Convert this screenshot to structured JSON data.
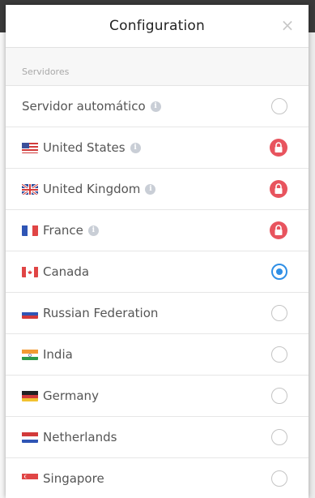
{
  "dialog": {
    "title": "Configuration",
    "close_glyph": "×"
  },
  "section": {
    "label": "Servidores"
  },
  "servers": [
    {
      "label": "Servidor automático",
      "flag": "",
      "info": true,
      "state": "unselected"
    },
    {
      "label": "United States",
      "flag": "us",
      "info": true,
      "state": "locked"
    },
    {
      "label": "United Kingdom",
      "flag": "gb",
      "info": true,
      "state": "locked"
    },
    {
      "label": "France",
      "flag": "fr",
      "info": true,
      "state": "locked"
    },
    {
      "label": "Canada",
      "flag": "ca",
      "info": false,
      "state": "selected"
    },
    {
      "label": "Russian Federation",
      "flag": "ru",
      "info": false,
      "state": "unselected"
    },
    {
      "label": "India",
      "flag": "in",
      "info": false,
      "state": "unselected"
    },
    {
      "label": "Germany",
      "flag": "de",
      "info": false,
      "state": "unselected"
    },
    {
      "label": "Netherlands",
      "flag": "nl",
      "info": false,
      "state": "unselected"
    },
    {
      "label": "Singapore",
      "flag": "sg",
      "info": false,
      "state": "unselected"
    }
  ],
  "colors": {
    "accent": "#2f8fe6",
    "lock": "#e8545e"
  },
  "icons": {
    "info": "info-icon",
    "lock": "lock-icon",
    "close": "close-icon"
  }
}
